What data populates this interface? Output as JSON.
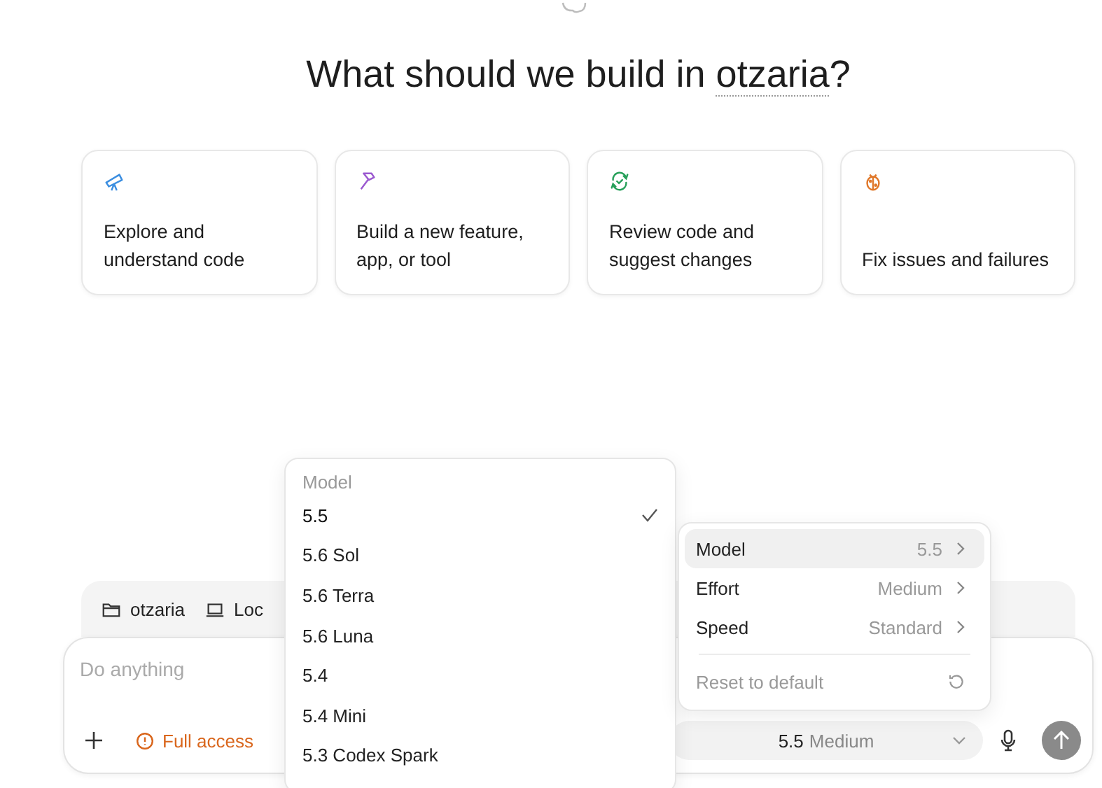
{
  "heading": {
    "before": "What should we build in ",
    "project": "otzaria",
    "after": "?"
  },
  "cards": [
    {
      "kind": "explore",
      "text": "Explore and understand code"
    },
    {
      "kind": "build",
      "text": "Build a new feature, app, or tool"
    },
    {
      "kind": "review",
      "text": "Review code and suggest changes"
    },
    {
      "kind": "fix",
      "text": "Fix issues and failures"
    }
  ],
  "context_chips": [
    {
      "kind": "folder",
      "label": "otzaria"
    },
    {
      "kind": "laptop",
      "label": "Loc"
    }
  ],
  "composer": {
    "placeholder": "Do anything",
    "access": "Full access",
    "model": "5.5",
    "effort": "Medium"
  },
  "model_menu": {
    "title": "Model",
    "items": [
      {
        "label": "5.5",
        "selected": true
      },
      {
        "label": "5.6 Sol",
        "selected": false
      },
      {
        "label": "5.6 Terra",
        "selected": false
      },
      {
        "label": "5.6 Luna",
        "selected": false
      },
      {
        "label": "5.4",
        "selected": false
      },
      {
        "label": "5.4 Mini",
        "selected": false
      },
      {
        "label": "5.3 Codex Spark",
        "selected": false
      }
    ]
  },
  "settings_menu": {
    "items": [
      {
        "label": "Model",
        "value": "5.5",
        "selected": true
      },
      {
        "label": "Effort",
        "value": "Medium",
        "selected": false
      },
      {
        "label": "Speed",
        "value": "Standard",
        "selected": false
      }
    ],
    "reset": {
      "label": "Reset to default",
      "disabled": true
    }
  }
}
